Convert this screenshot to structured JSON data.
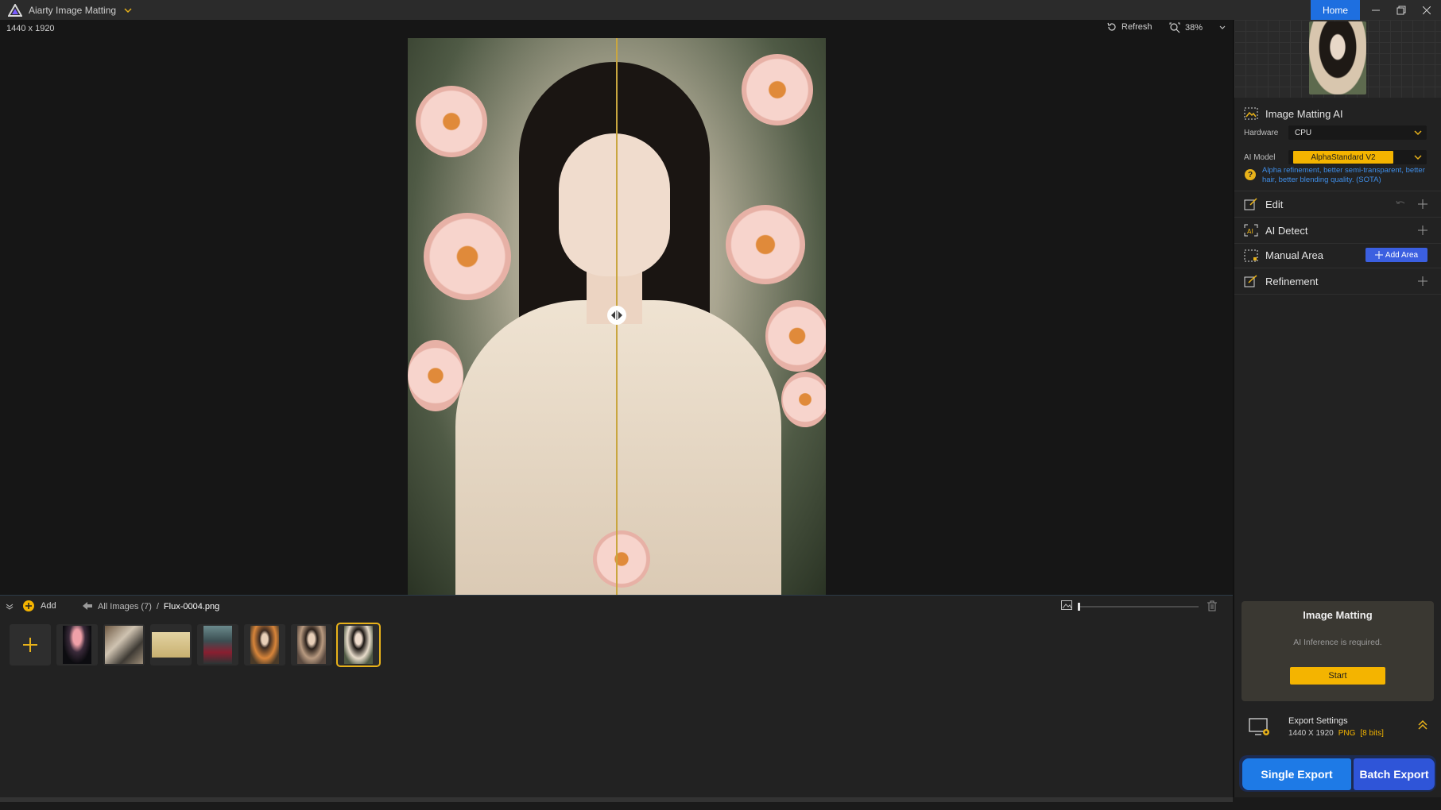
{
  "app": {
    "title": "Aiarty Image Matting",
    "home_tab": "Home"
  },
  "canvas": {
    "dimensions": "1440 x 1920",
    "refresh_label": "Refresh",
    "zoom": "38%"
  },
  "filmstrip": {
    "add_label": "Add",
    "breadcrumb_root": "All Images (7)",
    "breadcrumb_sep": "/",
    "breadcrumb_current": "Flux-0004.png",
    "thumbnails": [
      {
        "subject": "jellyfish"
      },
      {
        "subject": "driftwood"
      },
      {
        "subject": "bicycle"
      },
      {
        "subject": "woman in red dress"
      },
      {
        "subject": "woman with flowers"
      },
      {
        "subject": "woman portrait"
      },
      {
        "subject": "woman with peonies",
        "selected": true
      }
    ]
  },
  "panel": {
    "matting_ai_title": "Image Matting AI",
    "hardware_label": "Hardware",
    "hardware_value": "CPU",
    "ai_model_label": "AI Model",
    "ai_model_value": "AlphaStandard  V2",
    "model_hint": "Alpha refinement, better semi-transparent, better hair, better blending quality. (SOTA)",
    "edit_label": "Edit",
    "ai_detect_label": "AI Detect",
    "manual_area_label": "Manual Area",
    "add_area_label": "Add Area",
    "refinement_label": "Refinement",
    "matting_card_title": "Image Matting",
    "matting_card_sub": "AI Inference is required.",
    "start_label": "Start",
    "export_settings_title": "Export Settings",
    "export_dims": "1440 X 1920",
    "export_format": "PNG",
    "export_bits": "[8 bits]",
    "single_export_label": "Single Export",
    "batch_export_label": "Batch Export"
  },
  "colors": {
    "accent_yellow": "#f4b400",
    "home_blue": "#1e6fe0",
    "export_blue": "#1e7ae6",
    "batch_blue": "#2f55d8",
    "hint_blue": "#3f8ee8"
  }
}
